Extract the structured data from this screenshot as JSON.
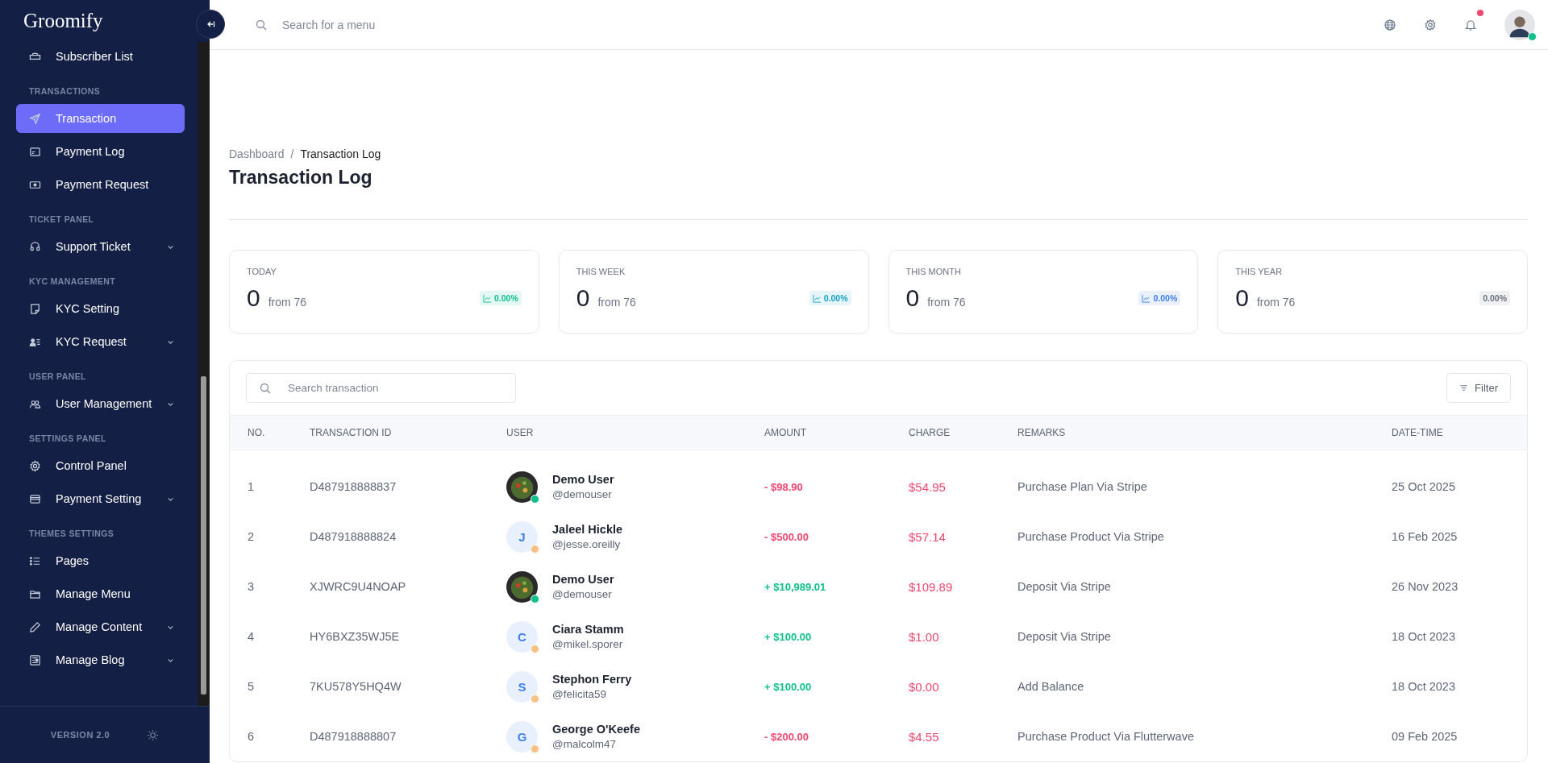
{
  "sidebar": {
    "logo": "Groomify",
    "sections": [
      {
        "items": [
          {
            "label": "Subscriber List",
            "expandable": false,
            "selected": false
          }
        ]
      },
      {
        "label": "TRANSACTIONS",
        "items": [
          {
            "label": "Transaction",
            "expandable": false,
            "selected": true
          },
          {
            "label": "Payment Log",
            "expandable": false,
            "selected": false
          },
          {
            "label": "Payment Request",
            "expandable": false,
            "selected": false
          }
        ]
      },
      {
        "label": "TICKET PANEL",
        "items": [
          {
            "label": "Support Ticket",
            "expandable": true,
            "selected": false
          }
        ]
      },
      {
        "label": "KYC MANAGEMENT",
        "items": [
          {
            "label": "KYC Setting",
            "expandable": false,
            "selected": false
          },
          {
            "label": "KYC Request",
            "expandable": true,
            "selected": false
          }
        ]
      },
      {
        "label": "USER PANEL",
        "items": [
          {
            "label": "User Management",
            "expandable": true,
            "selected": false
          }
        ]
      },
      {
        "label": "SETTINGS PANEL",
        "items": [
          {
            "label": "Control Panel",
            "expandable": false,
            "selected": false
          },
          {
            "label": "Payment Setting",
            "expandable": true,
            "selected": false
          }
        ]
      },
      {
        "label": "THEMES SETTINGS",
        "items": [
          {
            "label": "Pages",
            "expandable": false,
            "selected": false
          },
          {
            "label": "Manage Menu",
            "expandable": false,
            "selected": false
          },
          {
            "label": "Manage Content",
            "expandable": true,
            "selected": false
          },
          {
            "label": "Manage Blog",
            "expandable": true,
            "selected": false
          }
        ]
      }
    ],
    "version": "VERSION 2.0"
  },
  "topbar": {
    "search": {
      "placeholder": "Search for a menu"
    },
    "notification_dot": true,
    "online_dot": true
  },
  "breadcrumb": {
    "items": [
      "Dashboard",
      "Transaction Log"
    ],
    "separator": "/"
  },
  "title": "Transaction Log",
  "stats": [
    {
      "label": "TODAY",
      "value": "0",
      "from": "from 76",
      "change": "0.00%",
      "trend_icon": true,
      "color": "#0fbf8f"
    },
    {
      "label": "THIS WEEK",
      "value": "0",
      "from": "from 76",
      "change": "0.00%",
      "trend_icon": true,
      "color": "#1aa3c4"
    },
    {
      "label": "THIS MONTH",
      "value": "0",
      "from": "from 76",
      "change": "0.00%",
      "trend_icon": true,
      "color": "#3d7ef0"
    },
    {
      "label": "THIS YEAR",
      "value": "0",
      "from": "from 76",
      "change": "0.00%",
      "trend_icon": false,
      "color": "#6b7280"
    }
  ],
  "table": {
    "search": {
      "placeholder": "Search transaction"
    },
    "filter": "Filter",
    "columns": [
      "NO.",
      "TRANSACTION ID",
      "USER",
      "AMOUNT",
      "CHARGE",
      "REMARKS",
      "DATE-TIME"
    ],
    "rows": [
      {
        "kind": "debit",
        "no": "1",
        "id": "D487918888837",
        "avatar": {
          "kind": "photo",
          "color": "#10c08a"
        },
        "name": "Demo User",
        "handle": "@demouser",
        "amount": "- $98.90",
        "charge": "$54.95",
        "remarks": "Purchase Plan Via Stripe",
        "date": "25 Oct 2025"
      },
      {
        "kind": "debit",
        "no": "2",
        "id": "D487918888824",
        "avatar": {
          "kind": "initial",
          "initial": "J",
          "color": "#f5c185"
        },
        "name": "Jaleel Hickle",
        "handle": "@jesse.oreilly",
        "amount": "- $500.00",
        "charge": "$57.14",
        "remarks": "Purchase Product Via Stripe",
        "date": "16 Feb 2025"
      },
      {
        "kind": "credit",
        "no": "3",
        "id": "XJWRC9U4NOAP",
        "avatar": {
          "kind": "photo",
          "color": "#10c08a"
        },
        "name": "Demo User",
        "handle": "@demouser",
        "amount": "+ $10,989.01",
        "charge": "$109.89",
        "remarks": "Deposit Via Stripe",
        "date": "26 Nov 2023"
      },
      {
        "kind": "credit",
        "no": "4",
        "id": "HY6BXZ35WJ5E",
        "avatar": {
          "kind": "initial",
          "initial": "C",
          "color": "#f5c185"
        },
        "name": "Ciara Stamm",
        "handle": "@mikel.sporer",
        "amount": "+ $100.00",
        "charge": "$1.00",
        "remarks": "Deposit Via Stripe",
        "date": "18 Oct 2023"
      },
      {
        "kind": "credit",
        "no": "5",
        "id": "7KU578Y5HQ4W",
        "avatar": {
          "kind": "initial",
          "initial": "S",
          "color": "#f5c185"
        },
        "name": "Stephon Ferry",
        "handle": "@felicita59",
        "amount": "+ $100.00",
        "charge": "$0.00",
        "remarks": "Add Balance",
        "date": "18 Oct 2023"
      },
      {
        "kind": "debit",
        "no": "6",
        "id": "D487918888807",
        "avatar": {
          "kind": "initial",
          "initial": "G",
          "color": "#f5c185"
        },
        "name": "George O'Keefe",
        "handle": "@malcolm47",
        "amount": "- $200.00",
        "charge": "$4.55",
        "remarks": "Purchase Product Via Flutterwave",
        "date": "09 Feb 2025"
      }
    ]
  }
}
